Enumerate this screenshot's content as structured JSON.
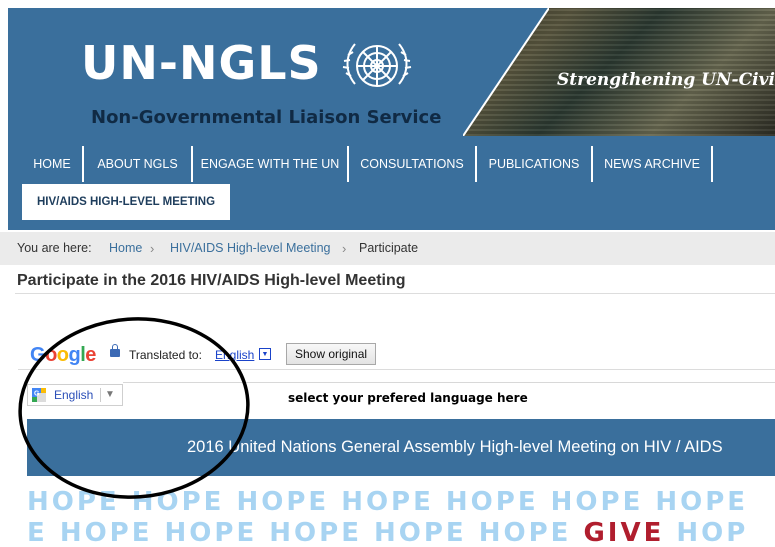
{
  "header": {
    "logo_text": "UN-NGLS",
    "logo_subtitle": "Non-Governmental Liaison Service",
    "tagline": "Strengthening UN-Civil So",
    "emblem_icon": "un-emblem-icon"
  },
  "nav": {
    "items": [
      {
        "label": "HOME"
      },
      {
        "label": "ABOUT NGLS"
      },
      {
        "label": "ENGAGE WITH THE UN"
      },
      {
        "label": "CONSULTATIONS"
      },
      {
        "label": "PUBLICATIONS"
      },
      {
        "label": "NEWS ARCHIVE"
      }
    ],
    "active": "HIV/AIDS HIGH-LEVEL MEETING"
  },
  "breadcrumb": {
    "prefix": "You are here:",
    "items": [
      "Home",
      "HIV/AIDS High-level Meeting",
      "Participate"
    ]
  },
  "page_title": "Participate in the 2016 HIV/AIDS High-level Meeting",
  "translate_bar": {
    "brand": "Google",
    "label": "Translated to:",
    "language": "English",
    "dropdown_glyph": "▼",
    "show_original": "Show original"
  },
  "translate_widget": {
    "language": "English",
    "arrow": "▼"
  },
  "hint": "select your prefered language here",
  "meeting_banner": "2016 United Nations General Assembly High-level Meeting on HIV / AIDS",
  "hope_rows": {
    "row1": "HOPE HOPE HOPE HOPE  HOPE HOPE HOPE",
    "row2_before": "E HOPE HOPE HOPE HOPE HOPE ",
    "row2_highlight": "GIVE",
    "row2_after": " HOP"
  },
  "colors": {
    "brand_blue": "#3a6f9c",
    "hope_light": "#a8d4f2",
    "give_red": "#b01e2e"
  }
}
